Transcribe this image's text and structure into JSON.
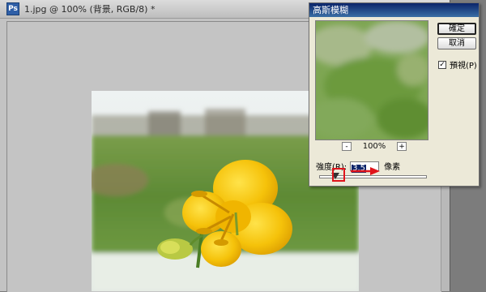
{
  "document": {
    "title": "1.jpg @ 100% (背景, RGB/8) *",
    "app_icon_glyph": "Ps"
  },
  "dialog": {
    "title": "高斯模糊",
    "ok_label": "確定",
    "cancel_label": "取消",
    "preview_label": "預視(P)",
    "preview_checked": true,
    "zoom_out": "-",
    "zoom_level": "100%",
    "zoom_in": "+",
    "radius_label": "強度(R):",
    "radius_value": "3.5",
    "radius_unit": "像素",
    "slider_level_fraction": 0.15
  },
  "colors": {
    "highlight": "#e0141b",
    "titlebar": "#0a246a"
  },
  "icons": {
    "checkmark": "check-icon",
    "annotation_arrow": "red-arrow-icon"
  }
}
